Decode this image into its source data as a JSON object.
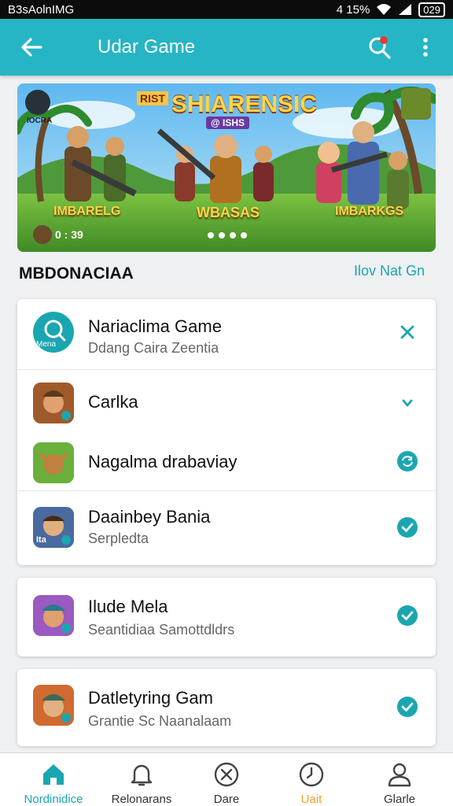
{
  "status_bar": {
    "left_text": "B3sAolnIMG",
    "signal_text": "4 15%",
    "battery_text": "029"
  },
  "app_bar": {
    "title": "Udar Game"
  },
  "banner": {
    "title": "SHIARENSIC",
    "subtitle": "@ ISHS",
    "corner_badge": "RIST",
    "left_caption": "IOCRA",
    "labels": [
      "IMBARELG",
      "WBASAS",
      "IMBARKGS"
    ],
    "timer": "0 : 39"
  },
  "section": {
    "title": "MBDONACIAA",
    "link": "Ilov Nat Gn"
  },
  "cards": [
    {
      "rows": [
        {
          "title": "Nariaclima Game",
          "subtitle": "Ddang Caira Zeentia",
          "icon": "search-icon",
          "icon_caption": "Mena",
          "action": "close-icon"
        },
        {
          "title": "Carlka",
          "subtitle": "",
          "icon": "game-warrior-icon",
          "action": "chevron-down-icon"
        },
        {
          "title": "Nagalma drabaviay",
          "subtitle": "",
          "icon": "game-goblin-icon",
          "action": "sync-icon"
        },
        {
          "title": "Daainbey Bania",
          "subtitle": "Serpledta",
          "icon": "game-hero-icon",
          "icon_caption": "Ita",
          "action": "check-circle-icon"
        }
      ]
    },
    {
      "rows": [
        {
          "title": "Ilude Mela",
          "subtitle": "Seantidiaa Samottdldrs",
          "icon": "game-soldier-icon",
          "action": "check-circle-icon"
        }
      ]
    },
    {
      "rows": [
        {
          "title": "Datletyring Gam",
          "subtitle": "Grantie Sc Naanalaam",
          "icon": "game-soldier-icon",
          "action": "check-circle-icon"
        }
      ]
    }
  ],
  "bottom_nav": [
    {
      "label": "Nordinidice",
      "icon": "home-icon"
    },
    {
      "label": "Relonarans",
      "icon": "bell-icon"
    },
    {
      "label": "Dare",
      "icon": "close-circle-icon"
    },
    {
      "label": "Uait",
      "icon": "clock-icon"
    },
    {
      "label": "Glarle",
      "icon": "user-icon"
    }
  ],
  "colors": {
    "accent": "#26b5c4",
    "link": "#1aa6b0",
    "active_nav": "#1aa6b0",
    "highlight_nav": "#f0a020"
  }
}
